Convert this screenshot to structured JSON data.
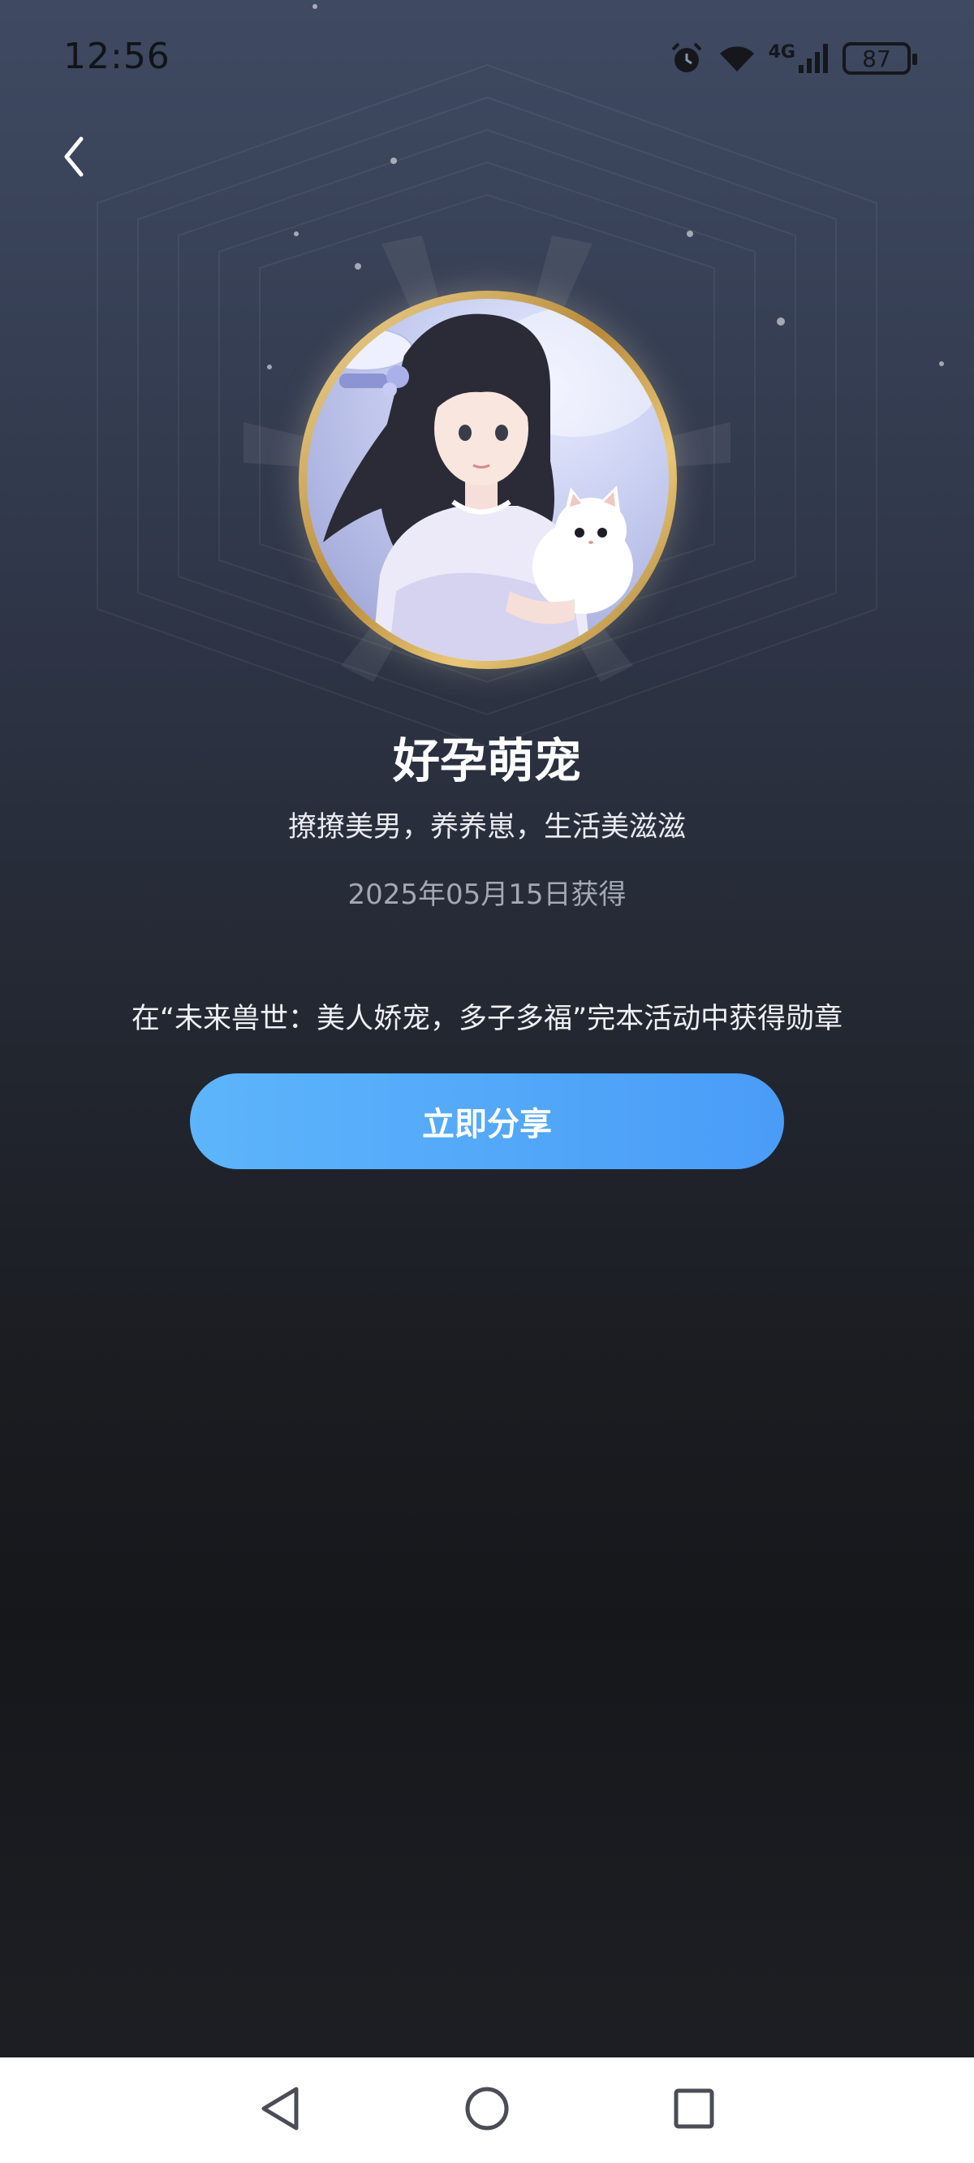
{
  "status_bar": {
    "time": "12:56",
    "network_label": "4G",
    "battery_level": "87",
    "icons": [
      "alarm-icon",
      "wifi-icon",
      "signal-icon",
      "battery-icon"
    ]
  },
  "header": {
    "back_icon": "chevron-left-icon"
  },
  "badge": {
    "title": "好孕萌宠",
    "subtitle": "撩撩美男，养养崽，生活美滋滋",
    "date": "2025年05月15日获得",
    "description": "在“未来兽世：美人娇宠，多子多福”完本活动中获得勋章",
    "share_label": "立即分享"
  },
  "nav": {
    "items": [
      "back-triangle-icon",
      "home-circle-icon",
      "recents-square-icon"
    ]
  },
  "colors": {
    "accent": "#4a9cf7",
    "accent_light": "#5db5fb",
    "gold": "#c9a04f"
  }
}
